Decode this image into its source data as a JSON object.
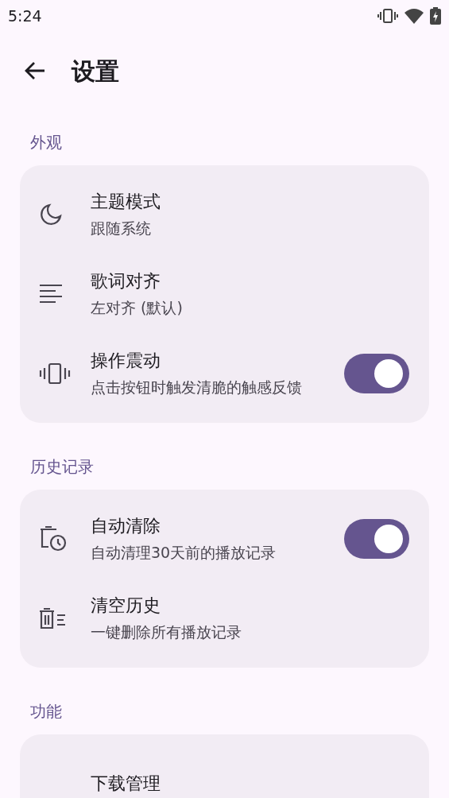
{
  "status_bar": {
    "time": "5:24"
  },
  "header": {
    "title": "设置"
  },
  "sections": [
    {
      "title": "外观",
      "items": [
        {
          "title": "主题模式",
          "subtitle": "跟随系统",
          "kind": "plain"
        },
        {
          "title": "歌词对齐",
          "subtitle": "左对齐 (默认)",
          "kind": "plain"
        },
        {
          "title": "操作震动",
          "subtitle": "点击按钮时触发清脆的触感反馈",
          "kind": "switch",
          "on": true
        }
      ]
    },
    {
      "title": "历史记录",
      "items": [
        {
          "title": "自动清除",
          "subtitle": "自动清理30天前的播放记录",
          "kind": "switch",
          "on": true
        },
        {
          "title": "清空历史",
          "subtitle": "一键删除所有播放记录",
          "kind": "plain"
        }
      ]
    },
    {
      "title": "功能",
      "items": [
        {
          "title": "下载管理",
          "kind": "plain"
        }
      ]
    }
  ]
}
